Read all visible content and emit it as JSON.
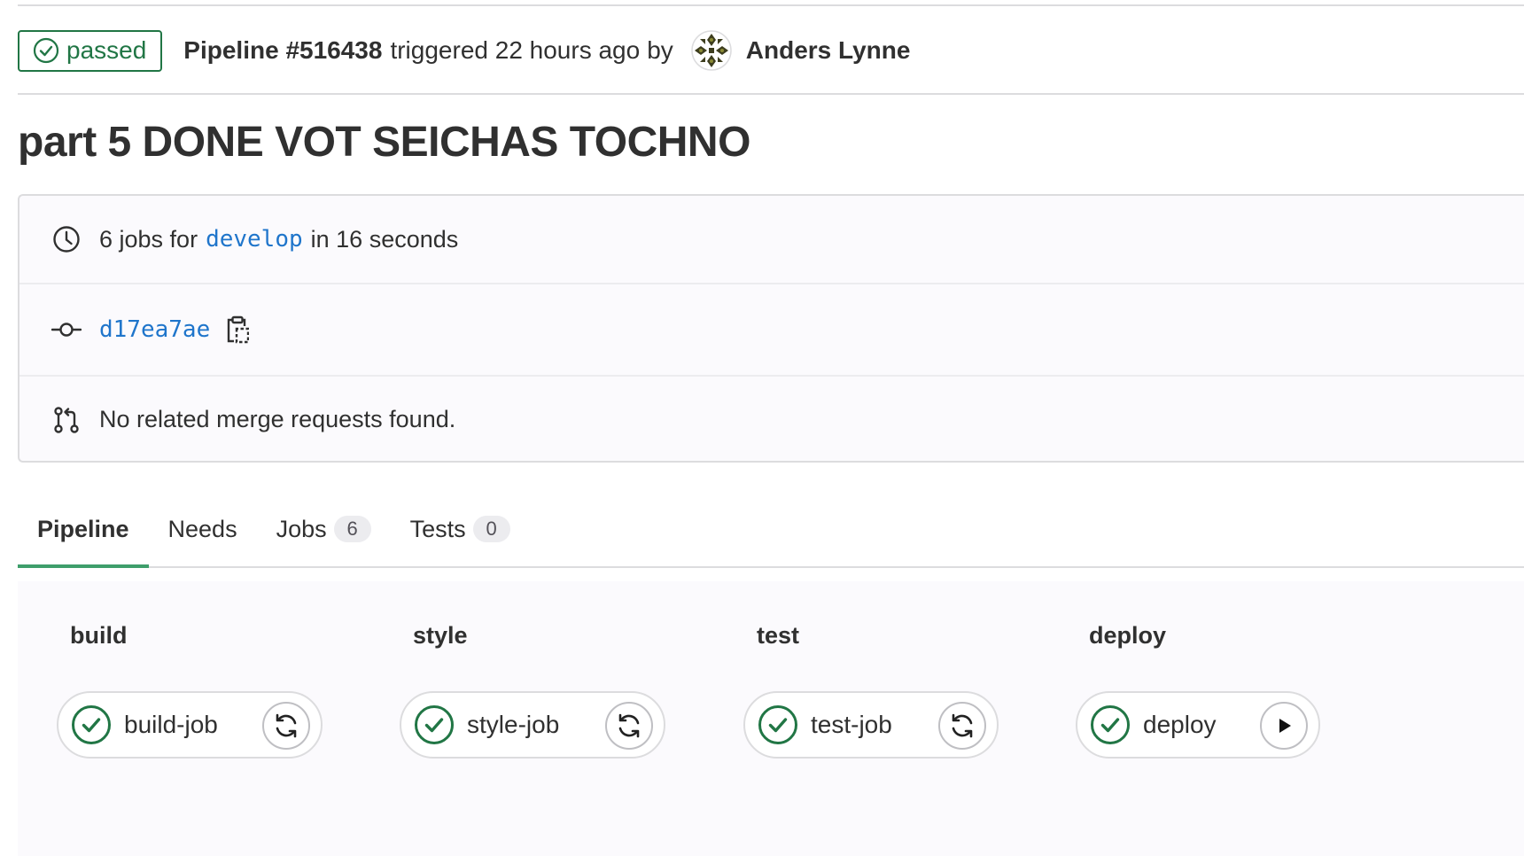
{
  "header": {
    "status_badge": "passed",
    "pipeline_id": "Pipeline #516438",
    "triggered_text": "triggered 22 hours ago",
    "by_text": "by",
    "author": "Anders Lynne"
  },
  "title": "part 5 DONE VOT SEICHAS TOCHNO",
  "info": {
    "jobs_prefix": "6 jobs for",
    "branch": "develop",
    "duration_text": "in 16 seconds",
    "commit_sha": "d17ea7ae",
    "merge_requests_text": "No related merge requests found."
  },
  "tabs": [
    {
      "label": "Pipeline"
    },
    {
      "label": "Needs"
    },
    {
      "label": "Jobs",
      "count": "6"
    },
    {
      "label": "Tests",
      "count": "0"
    }
  ],
  "stages": [
    {
      "name": "build",
      "job": "build-job",
      "action_icon": "retry-icon"
    },
    {
      "name": "style",
      "job": "style-job",
      "action_icon": "retry-icon"
    },
    {
      "name": "test",
      "job": "test-job",
      "action_icon": "retry-icon"
    },
    {
      "name": "deploy",
      "job": "deploy",
      "action_icon": "play-icon"
    }
  ],
  "colors": {
    "success": "#217645",
    "link": "#1f75cb",
    "tab_active": "#3e9e6b"
  }
}
